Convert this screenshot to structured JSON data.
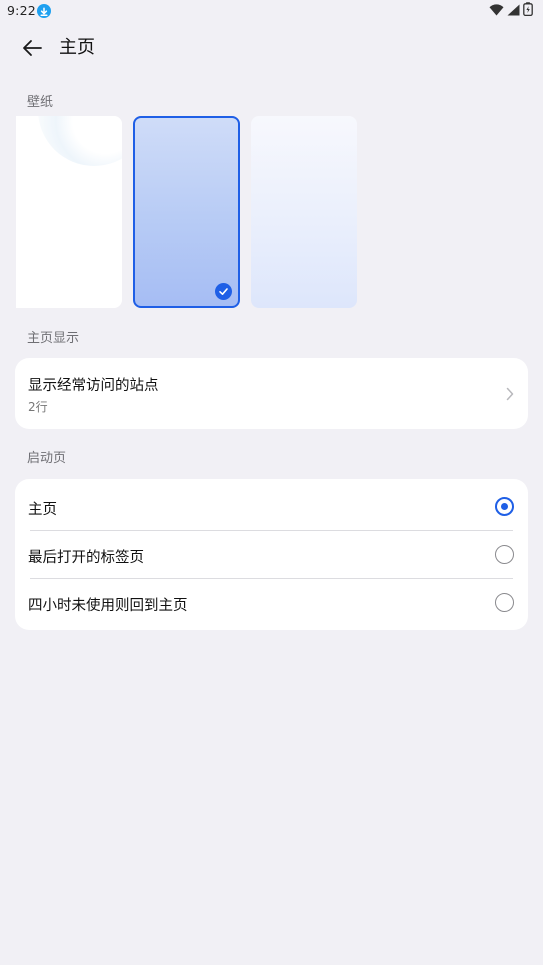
{
  "status_bar": {
    "time": "9:22"
  },
  "header": {
    "title": "主页"
  },
  "wallpaper": {
    "section_label": "壁纸",
    "selected_index": 1
  },
  "home_display": {
    "section_label": "主页显示",
    "title": "显示经常访问的站点",
    "subtitle": "2行"
  },
  "startup": {
    "section_label": "启动页",
    "options": [
      {
        "label": "主页",
        "selected": true
      },
      {
        "label": "最后打开的标签页",
        "selected": false
      },
      {
        "label": "四小时未使用则回到主页",
        "selected": false
      }
    ]
  },
  "colors": {
    "accent": "#1f5fe6",
    "background": "#f1f0f5",
    "card": "#ffffff"
  }
}
